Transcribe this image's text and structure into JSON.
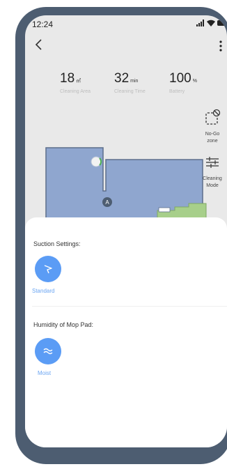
{
  "status_bar": {
    "time": "12:24"
  },
  "stats": [
    {
      "value": "18",
      "unit": "㎡",
      "label": "Cleaning Area"
    },
    {
      "value": "32",
      "unit": "min",
      "label": "Cleaning Time"
    },
    {
      "value": "100",
      "unit": "%",
      "label": "Battery"
    }
  ],
  "side_buttons": {
    "no_go": {
      "label_line1": "No-Go",
      "label_line2": "zone"
    },
    "cleaning_mode": {
      "label_line1": "Cleaning",
      "label_line2": "Mode"
    }
  },
  "map": {
    "marker_label": "A"
  },
  "sheet": {
    "suction_title": "Suction Settings:",
    "suction_mode": "Standard",
    "humidity_title": "Humidity of Mop Pad:",
    "humidity_mode": "Moist"
  },
  "colors": {
    "accent": "#5b9cf5",
    "map_room": "#8fa6cf",
    "map_room_edge": "#5d6f8c",
    "map_carpet": "#a7cf8a"
  }
}
